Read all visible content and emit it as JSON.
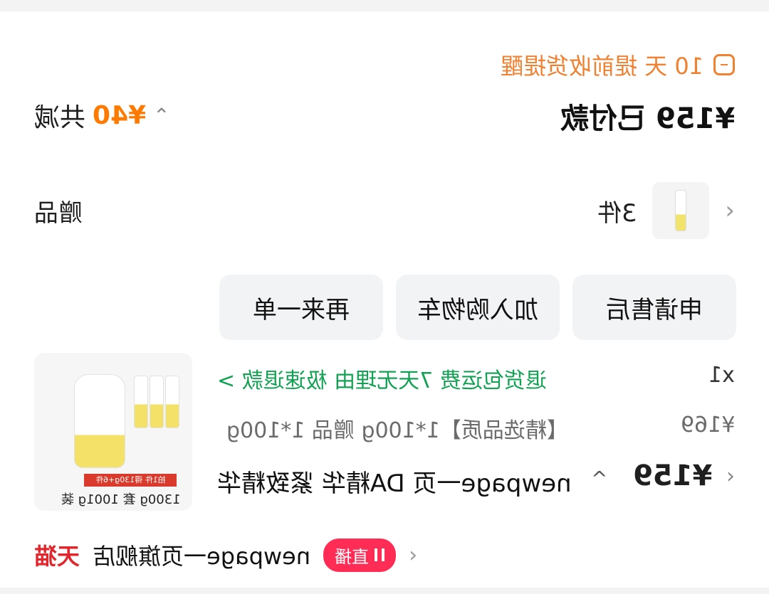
{
  "notice": {
    "text": "10 天 提前收货提醒",
    "icon": "info-square-icon"
  },
  "price": {
    "current": "¥159 已付款"
  },
  "discount": {
    "prefix": "共减",
    "amount": "¥40",
    "chevron": "up-icon"
  },
  "gift": {
    "label": "赠品",
    "count": "3件",
    "chevron": "chevron-right-icon"
  },
  "actions": [
    {
      "label": "申请售后"
    },
    {
      "label": "加入购物车"
    },
    {
      "label": "再来一单"
    }
  ],
  "product": {
    "thumb_caption": "1300g 套 1001g 装",
    "promo_banner": "拍1件 得130g+6件",
    "tag": "退货包运费 7天无理由 极速退款 >",
    "qty": "x1",
    "subtitle": "【精选品质】1*100g 赠品 1*100g",
    "unit_price": "¥169",
    "name": "newpage一页 DA精华 紧致精华",
    "price": "¥159",
    "price_chevron": "chevron-right-icon",
    "caret": "^"
  },
  "bottom": {
    "title": "天猫",
    "desc": "newpage一页旗舰店",
    "live_badge": "直播",
    "chevron": "chevron-right-icon"
  }
}
